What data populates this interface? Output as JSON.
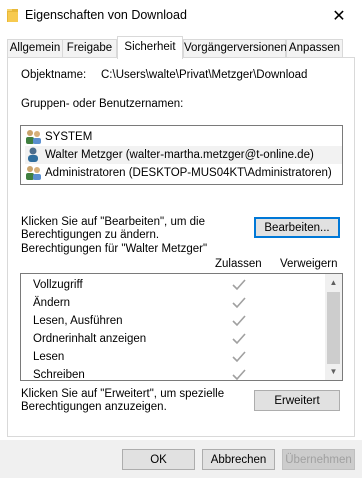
{
  "window": {
    "title": "Eigenschaften von Download",
    "close_glyph": "✕"
  },
  "tabs": [
    {
      "label": "Allgemein"
    },
    {
      "label": "Freigabe"
    },
    {
      "label": "Sicherheit"
    },
    {
      "label": "Vorgängerversionen"
    },
    {
      "label": "Anpassen"
    }
  ],
  "security": {
    "object_label": "Objektname:",
    "object_value": "C:\\Users\\walte\\Privat\\Metzger\\Download",
    "groups_label": "Gruppen- oder Benutzernamen:",
    "principals": [
      {
        "name": "SYSTEM",
        "icon": "group-icon"
      },
      {
        "name": "Walter Metzger (walter-martha.metzger@t-online.de)",
        "icon": "user-icon"
      },
      {
        "name": "Administratoren (DESKTOP-MUS04KT\\Administratoren)",
        "icon": "group-icon"
      }
    ],
    "edit_hint_line1": "Klicken Sie auf \"Bearbeiten\", um die",
    "edit_hint_line2": "Berechtigungen zu ändern.",
    "edit_button": "Bearbeiten...",
    "permissions_for": "Berechtigungen für \"Walter Metzger\"",
    "col_allow": "Zulassen",
    "col_deny": "Verweigern",
    "permissions": [
      {
        "name": "Vollzugriff",
        "allow": true,
        "deny": false
      },
      {
        "name": "Ändern",
        "allow": true,
        "deny": false
      },
      {
        "name": "Lesen, Ausführen",
        "allow": true,
        "deny": false
      },
      {
        "name": "Ordnerinhalt anzeigen",
        "allow": true,
        "deny": false
      },
      {
        "name": "Lesen",
        "allow": true,
        "deny": false
      },
      {
        "name": "Schreiben",
        "allow": true,
        "deny": false
      }
    ],
    "advanced_hint_line1": "Klicken Sie auf \"Erweitert\", um spezielle",
    "advanced_hint_line2": "Berechtigungen anzuzeigen.",
    "advanced_button": "Erweitert"
  },
  "footer": {
    "ok": "OK",
    "cancel": "Abbrechen",
    "apply": "Übernehmen"
  },
  "colors": {
    "focus_border": "#0078d7",
    "check_gray": "#a0a0a0"
  }
}
